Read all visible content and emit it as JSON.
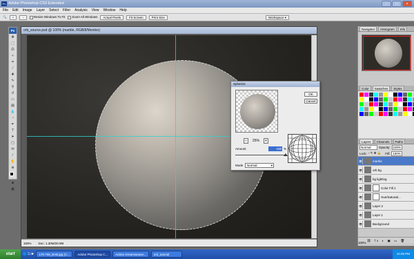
{
  "window": {
    "title": "Adobe Photoshop CS3 Extended",
    "app_icon": "Ps"
  },
  "menu": [
    "File",
    "Edit",
    "Image",
    "Layer",
    "Select",
    "Filter",
    "Analysis",
    "View",
    "Window",
    "Help"
  ],
  "options": {
    "resize_windows_label": "Resize Windows To Fit",
    "zoom_all_label": "Zoom All Windows",
    "actual_pixels": "Actual Pixels",
    "fit_screen": "Fit Screen",
    "print_size": "Print Size",
    "workspace": "Workspace"
  },
  "toolbox": {
    "logo": "Ps"
  },
  "document": {
    "title": "orb_source.psd @ 100% (marble, RGB/8/Monitor)",
    "zoom": "100%",
    "doc_size": "Doc: 1.30M/20.9M"
  },
  "dialog": {
    "title": "Spherize",
    "ok": "OK",
    "cancel": "Cancel",
    "preview_zoom": "25%",
    "amount_label": "Amount",
    "amount_value": "100",
    "amount_unit": "%",
    "mode_label": "Mode",
    "mode_value": "Normal"
  },
  "panels": {
    "navigator_tabs": [
      "Navigator",
      "Histogram",
      "Info"
    ],
    "color_tabs": [
      "Color",
      "Swatches",
      "Styles"
    ],
    "layers_tabs": [
      "Layers",
      "Channels",
      "Paths"
    ],
    "blend_mode": "Normal",
    "opacity_label": "Opacity:",
    "opacity": "100%",
    "lock_label": "Lock:",
    "fill_label": "Fill:",
    "fill": "100%",
    "zoom": "100%",
    "layers": [
      {
        "name": "marble",
        "selected": true,
        "mask": false
      },
      {
        "name": "orb bg",
        "selected": false,
        "mask": false
      },
      {
        "name": "bg lighting",
        "selected": false,
        "mask": false
      },
      {
        "name": "Color Fill 1",
        "selected": false,
        "mask": true
      },
      {
        "name": "Hue/Saturati...",
        "selected": false,
        "mask": true
      },
      {
        "name": "Layer 2",
        "selected": false,
        "mask": false
      },
      {
        "name": "Layer 1",
        "selected": false,
        "mask": false
      },
      {
        "name": "Background",
        "selected": false,
        "mask": false
      }
    ]
  },
  "taskbar": {
    "start": "start",
    "tasks": [
      "178-708_BAB.jpg (C...",
      "Adobe Photoshop C...",
      "Adobe Dreamweave...",
      "orb_tutorial"
    ],
    "clock": "10:25 PM"
  },
  "colors": {
    "guide": "#2fd2d2",
    "selection": "#4a79c9"
  }
}
